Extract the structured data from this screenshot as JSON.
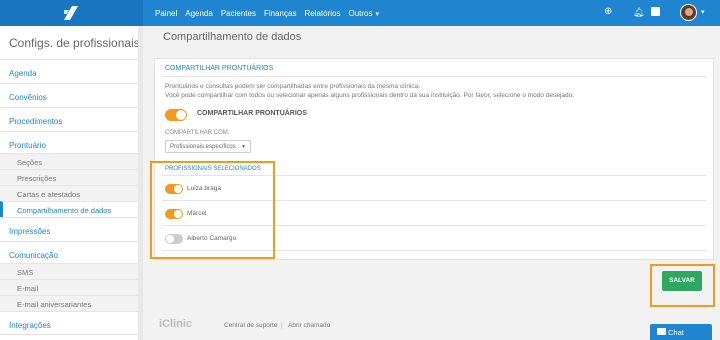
{
  "topbar": {
    "nav": [
      "Painel",
      "Agenda",
      "Pacientes",
      "Finanças",
      "Relatórios",
      "Outros"
    ],
    "outros_chevron": "chevron-down-icon",
    "icons": [
      "plus-circle-icon",
      "bell-icon",
      "gift-icon"
    ],
    "accent": "#1f85d1"
  },
  "sidebar": {
    "title": "Configs. de profissionais",
    "sections": [
      {
        "label": "Agenda"
      },
      {
        "label": "Convênios"
      },
      {
        "label": "Procedimentos"
      },
      {
        "label": "Prontuário",
        "items": [
          "Seções",
          "Prescrições",
          "Cartas e atestados",
          "Compartilhamento de dados"
        ]
      },
      {
        "label": "Impressões"
      },
      {
        "label": "Comunicação",
        "items": [
          "SMS",
          "E-mail",
          "E-mail aniversariantes"
        ]
      },
      {
        "label": "Integrações"
      }
    ],
    "active_item": "Compartilhamento de dados"
  },
  "main": {
    "title": "Compartilhamento de dados",
    "card_header": "COMPARTILHAR PRONTUÁRIOS",
    "desc1": "Prontuários e consultas podem ser compartilhadas entre profissionais da mesma clínica.",
    "desc2": "Você pode compartilhar com todos ou selecionar apenas alguns profissionais dentro da sua instituição. Por favor, selecione o modo desejado:",
    "share_toggle_label": "COMPARTILHAR PRONTUÁRIOS",
    "share_toggle_on": true,
    "share_with_label": "COMPARTILHAR COM:",
    "share_with_value": "Profissionais específicos",
    "selected_label": "PROFISSIONAIS SELECIONADOS",
    "professionals": [
      {
        "name": "Luiza braga",
        "enabled": true
      },
      {
        "name": "Marcel",
        "enabled": true
      },
      {
        "name": "Alberto Camargo",
        "enabled": false
      }
    ],
    "save_label": "SALVAR"
  },
  "footer": {
    "logo": "iClinic",
    "support": "Central de suporte",
    "separator": "|",
    "ticket": "Abrir chamado"
  },
  "chat": {
    "label": "Chat"
  }
}
